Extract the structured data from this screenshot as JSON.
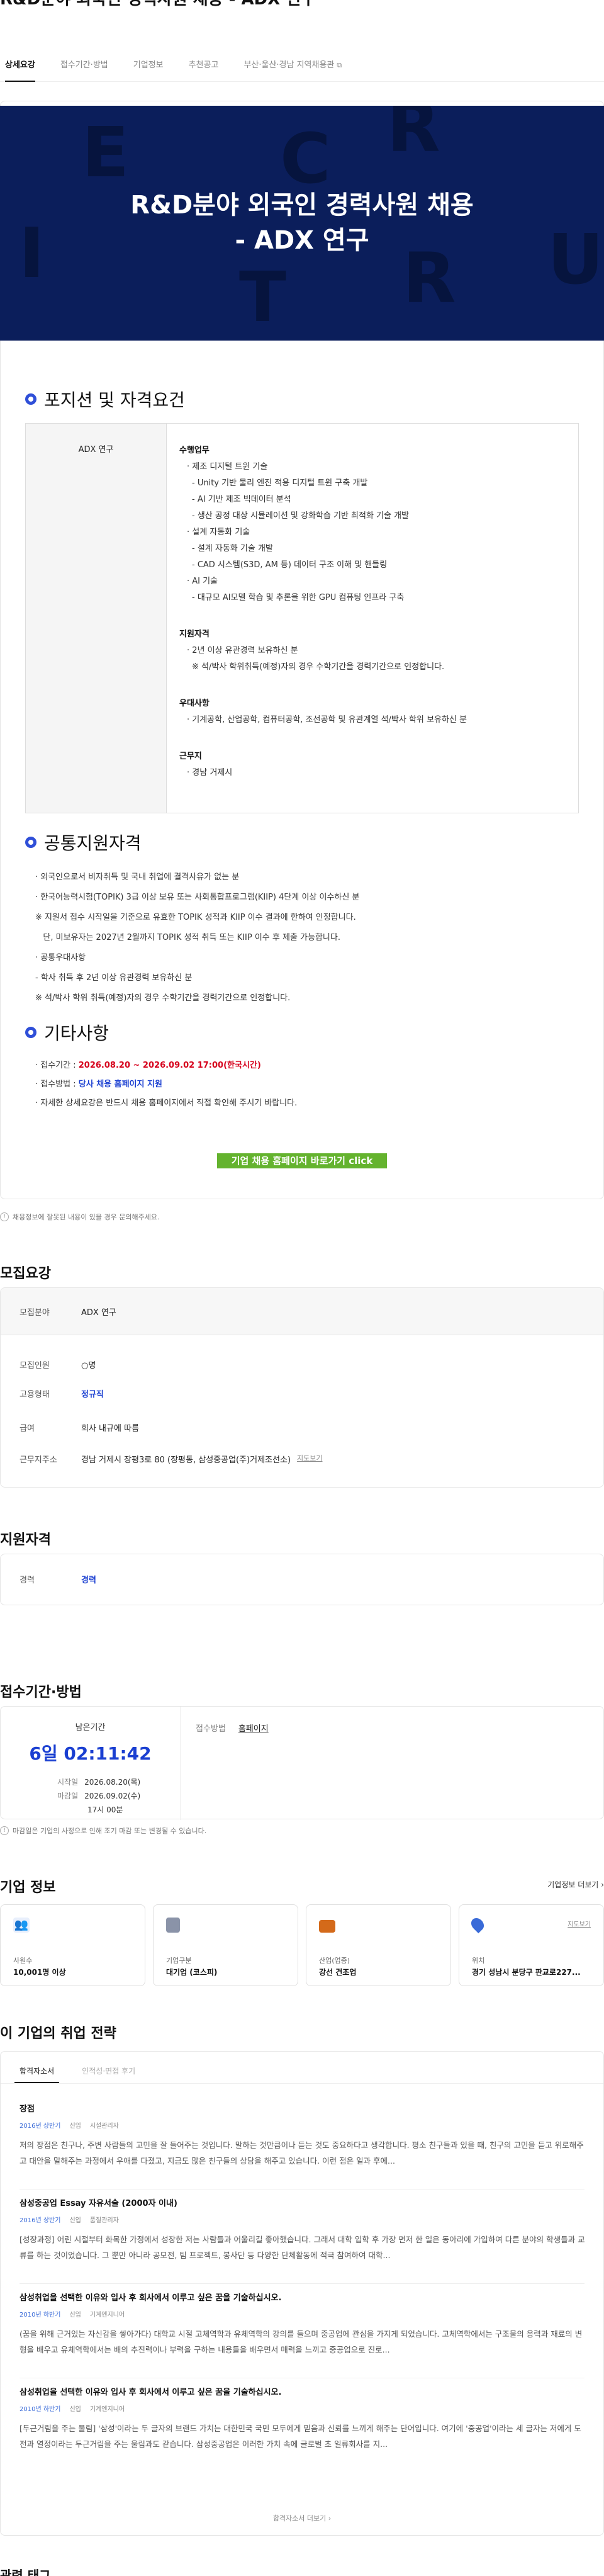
{
  "page": {
    "title": "R&D분야 외국인 경력사원 채용 - ADX 연구"
  },
  "tabs": [
    {
      "label": "상세요강"
    },
    {
      "label": "접수기간·방법"
    },
    {
      "label": "기업정보"
    },
    {
      "label": "추천공고"
    },
    {
      "label": "부산·울산·경남 지역채용관"
    }
  ],
  "banner": {
    "title_line1": "R&D분야 외국인 경력사원 채용",
    "title_line2": "- ADX 연구"
  },
  "position": {
    "heading": "포지션 및 자격요건",
    "name": "ADX 연구",
    "duty_h": "수행업무",
    "duties": [
      {
        "t": "· 제조 디지털 트윈 기술",
        "lv": 1
      },
      {
        "t": "- Unity 기반 물리 엔진 적용 디지털 트윈 구축 개발",
        "lv": 2
      },
      {
        "t": "- AI 기반 제조 빅데이터 분석",
        "lv": 2
      },
      {
        "t": "- 생산 공정 대상 시뮬레이션 및 강화학습 기반 최적화 기술 개발",
        "lv": 2
      },
      {
        "t": "· 설계 자동화 기술",
        "lv": 1
      },
      {
        "t": "- 설계 자동화 기술 개발",
        "lv": 2
      },
      {
        "t": "- CAD 시스템(S3D, AM 등) 데이터 구조 이해 및 핸들링",
        "lv": 2
      },
      {
        "t": "· AI 기술",
        "lv": 1
      },
      {
        "t": "- 대규모 AI모델 학습 및 추론을 위한 GPU 컴퓨팅 인프라 구축",
        "lv": 2
      }
    ],
    "qual_h": "지원자격",
    "quals": [
      {
        "t": "· 2년 이상 유관경력 보유하신 분",
        "lv": 1
      },
      {
        "t": "※ 석/박사 학위취득(예정)자의 경우 수학기간을 경력기간으로 인정합니다.",
        "lv": 2
      }
    ],
    "major_h": "우대사항",
    "majors": [
      {
        "t": "· 기계공학, 산업공학, 컴퓨터공학, 조선공학 및 유관계열 석/박사 학위 보유하신 분",
        "lv": 1
      }
    ],
    "loc_h": "근무지",
    "locs": [
      {
        "t": "· 경남 거제시",
        "lv": 1
      }
    ]
  },
  "common": {
    "heading": "공통지원자격",
    "lines": [
      "· 외국인으로서 비자취득 및 국내 취업에 결격사유가 없는 분",
      "· 한국어능력시험(TOPIK) 3급 이상 보유 또는 사회통합프로그램(KIIP) 4단계 이상 이수하신 분",
      "※ 지원서 접수 시작일을 기준으로 유효한 TOPIK 성적과 KIIP 이수 결과에 한하여 인정합니다.",
      "   단, 미보유자는 2027년 2월까지 TOPIK 성적 취득 또는 KIIP 이수 후 제출 가능합니다.",
      "· 공통우대사항",
      "- 학사 취득 후 2년 이상 유관경력 보유하신 분",
      "※ 석/박사 학위 취득(예정)자의 경우 수학기간을 경력기간으로 인정합니다."
    ]
  },
  "etc": {
    "heading": "기타사항",
    "period_label": "· 접수기간 : ",
    "period_value": "2026.08.20 ~ 2026.09.02  17:00(한국시간)",
    "method_label": "· 접수방법 : ",
    "method_value": "당사 채용 홈페이지 지원",
    "detail": "· 자세한 상세요강은 반드시 채용 홈페이지에서 직접 확인해 주시기 바랍니다.",
    "apply_button": "기업 채용 홈페이지 바로가기 click"
  },
  "notice": "채용정보에 잘못된 내용이 있을 경우 문의해주세요.",
  "summary": {
    "heading": "모집요강",
    "rows": [
      {
        "label": "모집분야",
        "value": "ADX 연구"
      },
      {
        "label": "모집인원",
        "value": "○명"
      },
      {
        "label": "고용형태",
        "value": "정규직"
      },
      {
        "label": "급여",
        "value": "회사 내규에 따름"
      },
      {
        "label": "근무지주소",
        "value": "경남 거제시 장평3로 80 (장평동, 삼성중공업(주)거제조선소)"
      }
    ],
    "map_link": "지도보기"
  },
  "qualification": {
    "heading": "지원자격",
    "label": "경력",
    "value": "경력"
  },
  "period": {
    "heading": "접수기간·방법",
    "remain_label": "남은기간",
    "countdown": "6일 02:11:42",
    "start_label": "시작일",
    "start_value": "2026.08.20(목)",
    "end_label": "마감일",
    "end_value": "2026.09.02(수)",
    "end_time": "17시 00분",
    "method_label": "접수방법",
    "method_value": "홈페이지",
    "notice": "마감일은 기업의 사정으로 인해 조기 마감 또는 변경될 수 있습니다."
  },
  "company": {
    "heading": "기업 정보",
    "more": "기업정보 더보기",
    "cards": [
      {
        "icon": "people-icon",
        "label": "사원수",
        "value": "10,001명 이상",
        "color": "#4a78e0"
      },
      {
        "icon": "building-icon",
        "label": "기업구분",
        "value": "대기업 (코스피)",
        "color": "#8a93a8"
      },
      {
        "icon": "briefcase-icon",
        "label": "산업(업종)",
        "value": "강선 건조업",
        "color": "#d46a1a"
      },
      {
        "icon": "location-pin-icon",
        "label": "위치",
        "value": "경기 성남시 분당구 판교로227...",
        "color": "#3a6bd8",
        "map": "지도보기"
      }
    ]
  },
  "strategy": {
    "heading": "이 기업의 취업 전략",
    "tabs": [
      {
        "label": "합격자소서"
      },
      {
        "label": "인적성·면접 후기"
      }
    ],
    "essays": [
      {
        "title": "장점",
        "year": "2016년 상반기",
        "type": "신입",
        "field": "시설관리자",
        "body": "저의 장점은 친구나, 주변 사람들의 고민을 잘 들어주는 것입니다. 말하는 것만큼이나 듣는 것도 중요하다고 생각합니다. 평소 친구들과 있을 때, 친구의 고민을 듣고 위로해주고 대안을 말해주는 과정에서 우애를 다졌고, 지금도 많은 친구들의 상담을 해주고 있습니다. 이런 점은 일과 후에..."
      },
      {
        "title": "삼성중공업 Essay 자유서술 (2000자 이내)",
        "year": "2016년 상반기",
        "type": "신입",
        "field": "품질관리자",
        "body": "[성장과정] 어린 시절부터 화목한 가정에서 성장한 저는 사람들과 어울리길 좋아했습니다. 그래서 대학 입학 후 가장 먼저 한 일은 동아리에 가입하여 다른 분야의 학생들과 교류를 하는 것이었습니다. 그 뿐만 아니라 공모전, 팀 프로젝트, 봉사단 등 다양한 단체활동에 적극 참여하여 대학..."
      },
      {
        "title": "삼성취업을 선택한 이유와 입사 후 회사에서 이루고 싶은 꿈을 기술하십시오.",
        "year": "2010년 하반기",
        "type": "신입",
        "field": "기계엔지니어",
        "body": "(꿈을 위해 근거있는 자신감을 쌓아가다) 대학교 시절 고체역학과 유체역학의 강의를 들으며 중공업에 관심을 가지게 되었습니다. 고체역학에서는 구조물의 응력과 재료의 변형을 배우고 유체역학에서는 배의 추진력이나 부력을 구하는 내용들을 배우면서 매력을 느끼고 중공업으로 진로..."
      },
      {
        "title": "삼성취업을 선택한 이유와 입사 후 회사에서 이루고 싶은 꿈을 기술하십시오.",
        "year": "2010년 하반기",
        "type": "신입",
        "field": "기계엔지니어",
        "body": "[두근거림을 주는 물림] '삼성'이라는 두 글자의 브랜드 가치는 대한민국 국민 모두에게 믿음과 신뢰를 느끼게 해주는 단어입니다. 여기에 '중공업'이라는 세 글자는 저에게 도전과 열정이라는 두근거림을 주는 울림과도 같습니다. 삼성중공업은 이러한 가치 속에 글로벌 초 일류회사를 지..."
      }
    ],
    "more": "합격자소서 더보기"
  },
  "related": {
    "heading": "관련 태그"
  },
  "colors": {
    "banner": "#0b1e5b",
    "accent": "#1a3fd1",
    "button": "#64b32e",
    "highlight": "#d6001c"
  }
}
